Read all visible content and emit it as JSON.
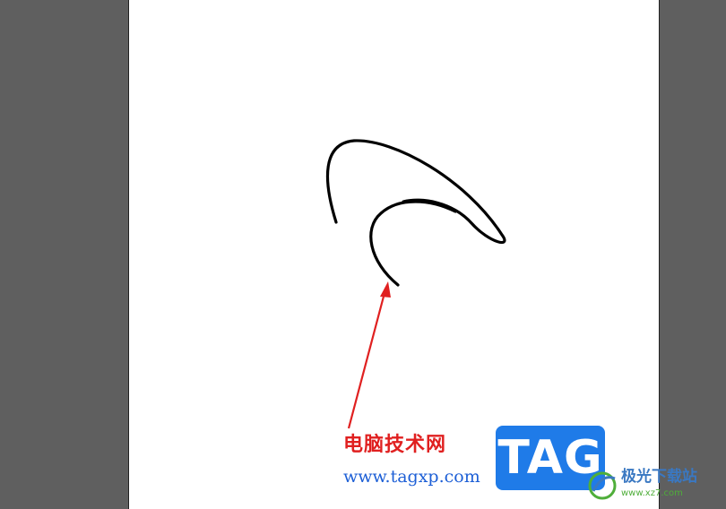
{
  "watermark": {
    "cn_text": "电脑技术网",
    "url_text": "www.tagxp.com",
    "logo_text": "TAG",
    "logo_color": "#1f7be8",
    "site_name": "极光下载站",
    "site_url": "www.xz7.com"
  },
  "colors": {
    "workspace": "#5f5f5f",
    "artboard": "#ffffff",
    "stroke": "#000000",
    "arrow": "#e02020"
  }
}
